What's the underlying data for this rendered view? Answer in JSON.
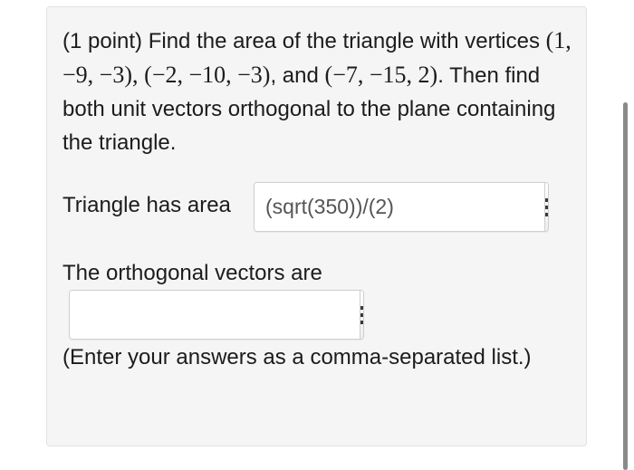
{
  "problem": {
    "points": "(1 point)",
    "prompt_part1": "Find the area of the triangle with vertices",
    "vertex_a": "(1, −9, −3)",
    "sep_1": ",",
    "vertex_b": "(−2, −10, −3)",
    "sep_2": ", and",
    "vertex_c": "(−7, −15, 2)",
    "prompt_part2": ". Then find both unit vectors orthogonal to the plane containing the triangle."
  },
  "area_row": {
    "label": "Triangle has area",
    "value": "(sqrt(350))/(2)"
  },
  "vectors_row": {
    "label": "The orthogonal vectors are",
    "value": ""
  },
  "instructions": "(Enter your answers as a comma-separated list.)",
  "icons": {
    "equation_editor": "grid-icon"
  }
}
